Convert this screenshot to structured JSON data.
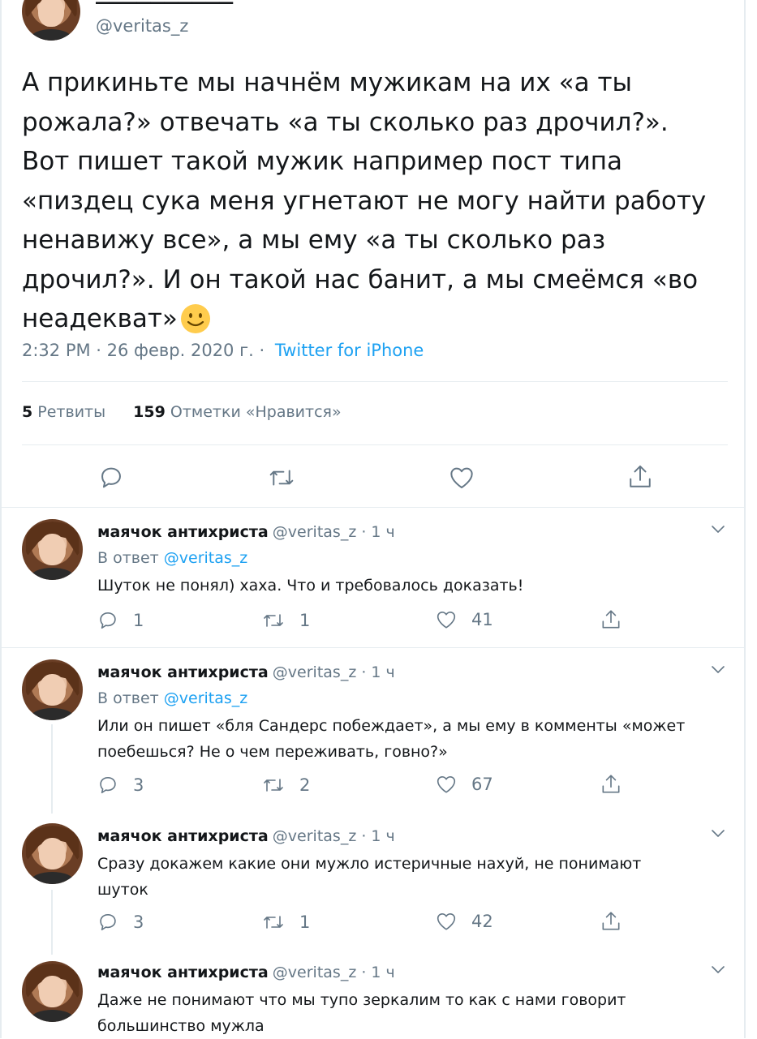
{
  "main_tweet": {
    "handle": "@veritas_z",
    "text": "А прикиньте мы начнём мужикам на их «а ты рожала?» отвечать «а ты сколько раз дрочил?». Вот пишет такой мужик например пост типа «пиздец сука меня угнетают не могу найти работу ненавижу все», а мы ему «а ты сколько раз дрочил?». И он такой нас банит, а мы смеёмся «во неадекват»",
    "text_lines": [
      "А прикиньте мы начнём мужикам на их «а ты",
      "рожала?» отвечать «а ты сколько раз дрочил?».",
      "Вот пишет такой мужик например пост типа",
      "«пиздец сука меня угнетают не могу найти работу",
      "ненавижу все», а мы ему «а ты сколько раз",
      "дрочил?». И он такой нас банит, а мы смеёмся «во",
      "неадекват»"
    ],
    "emoji": "🙂",
    "timestamp": "2:32 PM · 26 февр. 2020 г. ·",
    "source": "Twitter for iPhone",
    "retweets_count": "5",
    "retweets_label": "Ретвиты",
    "likes_count": "159",
    "likes_label": "Отметки «Нравится»"
  },
  "replies": [
    {
      "name": "маячок антихриста",
      "meta": "@veritas_z · 1 ч",
      "reply_to_prefix": "В ответ",
      "reply_to_handle": "@veritas_z",
      "text_lines": [
        "Шуток не понял) хаха. Что и требовалось доказать!"
      ],
      "reply_count": "1",
      "retweet_count": "1",
      "like_count": "41"
    },
    {
      "name": "маячок антихриста",
      "meta": "@veritas_z · 1 ч",
      "reply_to_prefix": "В ответ",
      "reply_to_handle": "@veritas_z",
      "text_lines": [
        "Или он пишет «бля Сандерс побеждает», а мы ему в комменты «может",
        "поебешься? Не о чем переживать, говно?»"
      ],
      "reply_count": "3",
      "retweet_count": "2",
      "like_count": "67"
    },
    {
      "name": "маячок антихриста",
      "meta": "@veritas_z · 1 ч",
      "text_lines": [
        "Сразу докажем какие они мужло истеричные нахуй, не понимают",
        "шуток"
      ],
      "reply_count": "3",
      "retweet_count": "1",
      "like_count": "42"
    },
    {
      "name": "маячок антихриста",
      "meta": "@veritas_z · 1 ч",
      "text_lines": [
        "Даже не понимают что мы тупо зеркалим то как с нами говорит",
        "большинство мужла"
      ]
    }
  ],
  "colors": {
    "text": "#14171a",
    "secondary": "#657786",
    "link": "#1da1f2",
    "divider": "#e6ecf0"
  }
}
